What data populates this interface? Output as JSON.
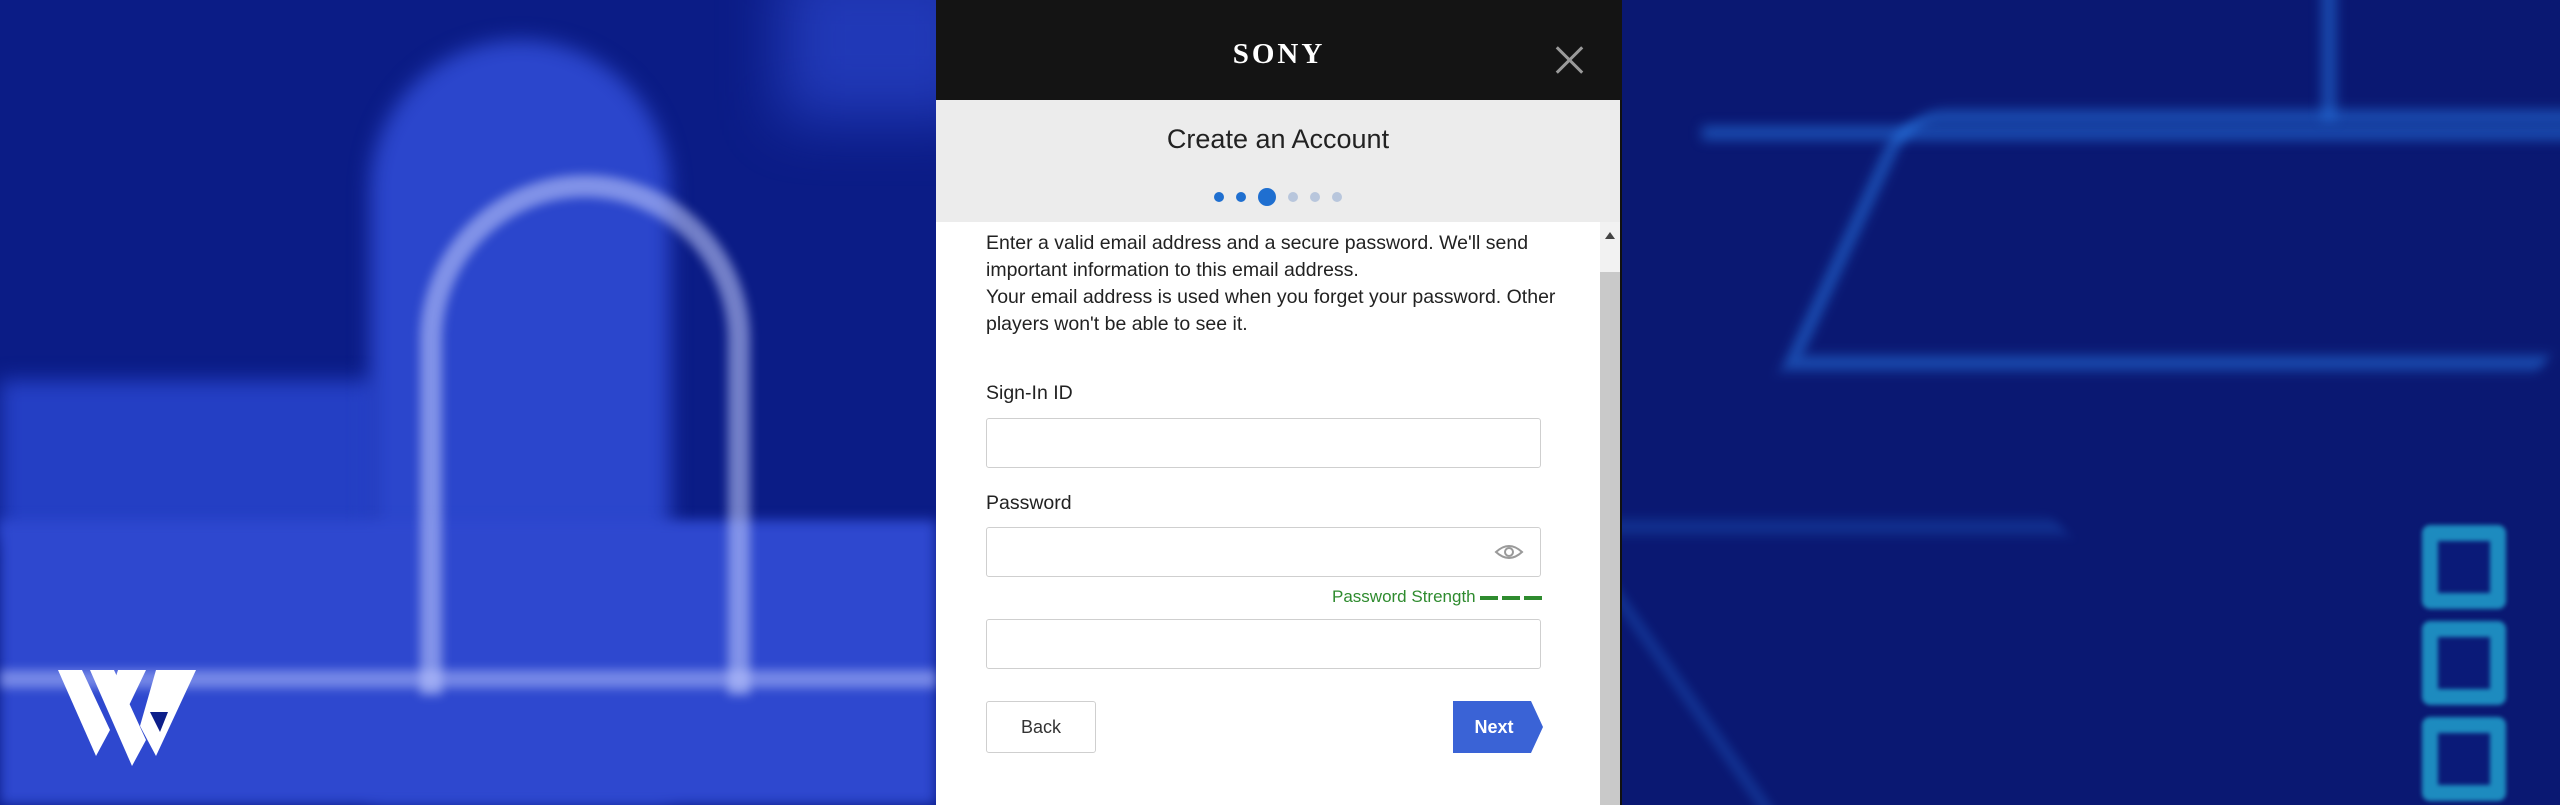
{
  "brand": {
    "name": "SONY"
  },
  "dialog": {
    "title": "Create an Account",
    "steps": {
      "total": 6,
      "current": 3
    },
    "intro": [
      "Enter a valid email address and a secure password. We'll send important information to this email address.",
      "Your email address is used when you forget your password. Other players won't be able to see it."
    ],
    "fields": {
      "sign_in_id": {
        "label": "Sign-In ID",
        "value": ""
      },
      "password": {
        "label": "Password",
        "value": ""
      },
      "confirm_password": {
        "value": ""
      }
    },
    "password_strength": {
      "label": "Password Strength",
      "color": "#2e8b2e"
    },
    "buttons": {
      "back": "Back",
      "next": "Next"
    },
    "colors": {
      "accent": "#1f6fd0",
      "next_button": "#3a63d6"
    }
  },
  "icons": [
    "close-icon",
    "eye-icon",
    "scroll-up-icon",
    "watermark-logo"
  ]
}
